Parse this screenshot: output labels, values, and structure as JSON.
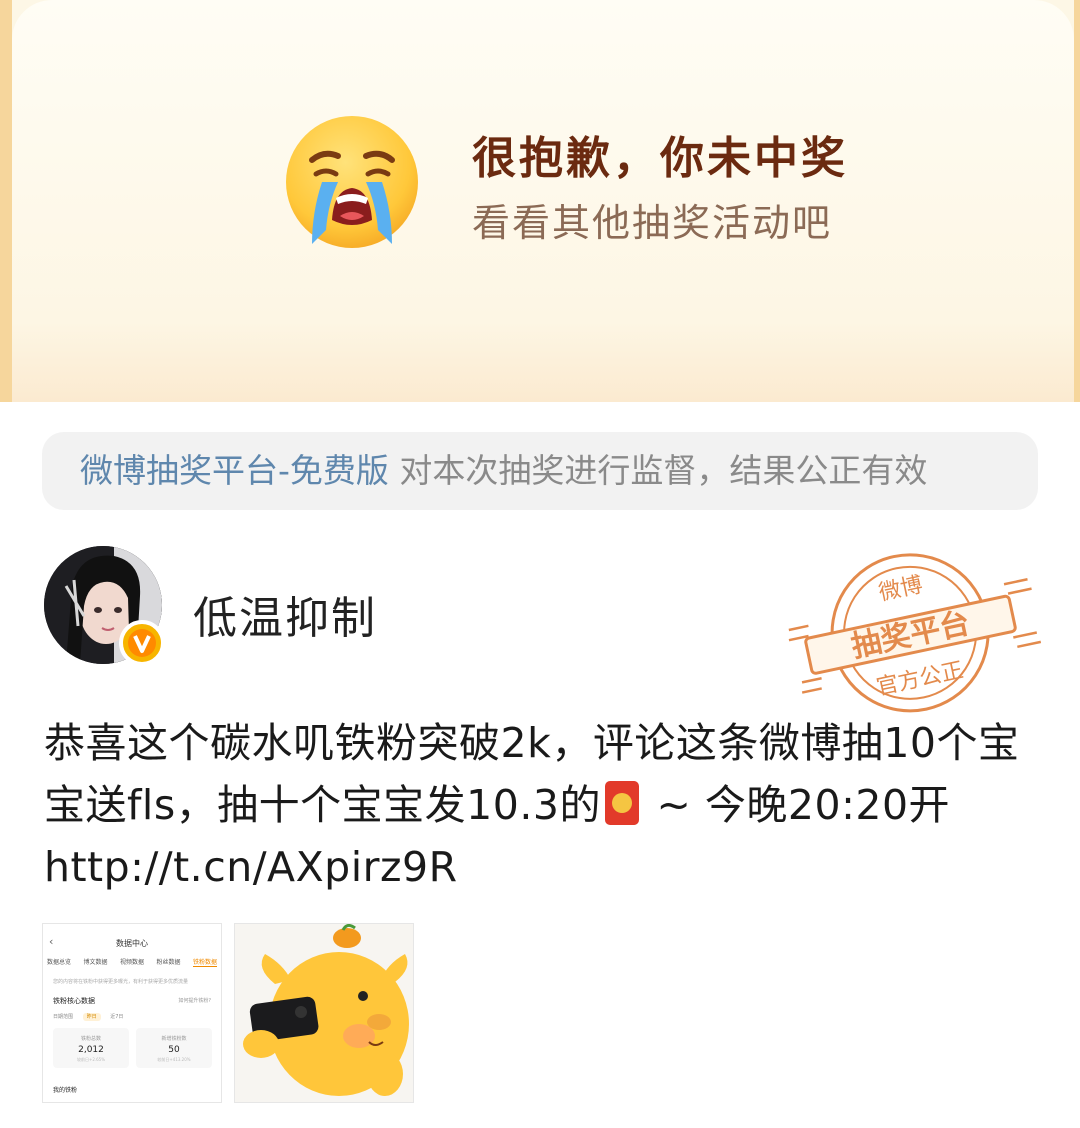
{
  "result": {
    "title": "很抱歉，你未中奖",
    "subtitle": "看看其他抽奖活动吧",
    "icon": "crying-face-icon"
  },
  "notice": {
    "platform": "微博抽奖平台-免费版",
    "text": " 对本次抽奖进行监督，结果公正有效"
  },
  "post": {
    "author": "低温抑制",
    "verified_badge": "V",
    "stamp": {
      "line1": "微博",
      "line2": "抽奖平台",
      "line3": "官方公正"
    },
    "text_before_emoji": "恭喜这个碳水叽铁粉突破2k，评论这条微博抽10个宝宝送fls，抽十个宝宝发10.3的",
    "emoji": "red-envelope-icon",
    "text_after_emoji": " ~ 今晚20:20开",
    "link": "http://t.cn/AXpirz9R"
  },
  "thumbnail1": {
    "title": "数据中心",
    "tabs": [
      "数据总览",
      "博文数据",
      "视频数据",
      "粉丝数据",
      "铁粉数据"
    ],
    "active_tab": 4,
    "hint": "您的内容将在铁粉中获得更多曝光，有利于获得更多优质流量",
    "section": "铁粉核心数据",
    "link": "如何提升铁粉?",
    "range_label": "日期范围",
    "range_options": [
      "昨日",
      "近7日"
    ],
    "box1": {
      "label": "铁粉总数",
      "value": "2,012",
      "compare": "较前日+2.65%"
    },
    "box2": {
      "label": "新增铁粉数",
      "value": "50",
      "compare": "较前日+413.20%"
    },
    "mine": "我的铁粉"
  },
  "thumbnail2": {
    "description": "orange-dog-photo"
  },
  "colors": {
    "title": "#6b2a10",
    "subtitle": "#8b6a55",
    "platform_link": "#5f87ad",
    "stamp": "#e38a4c",
    "badge": "#f7b500"
  }
}
